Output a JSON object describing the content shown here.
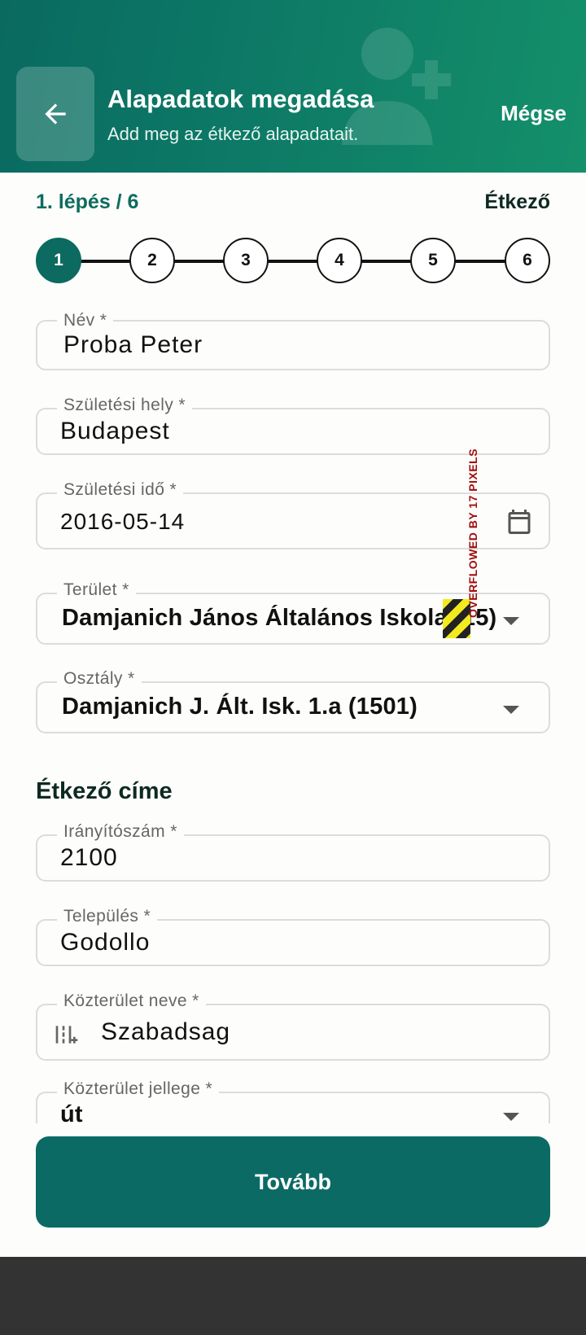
{
  "header": {
    "title": "Alapadatok megadása",
    "subtitle": "Add meg az étkező alapadatait.",
    "cancel_label": "Mégse",
    "back_icon": "arrow-left-icon",
    "decor_icon": "person-add-icon"
  },
  "progress": {
    "step_label": "1. lépés / 6",
    "role_label": "Étkező",
    "current_step": 1,
    "steps": [
      "1",
      "2",
      "3",
      "4",
      "5",
      "6"
    ]
  },
  "form": {
    "name": {
      "label": "Név *",
      "value": "Proba Peter"
    },
    "birth_place": {
      "label": "Születési hely *",
      "value": "Budapest"
    },
    "birth_date": {
      "label": "Születési idő *",
      "value": "2016-05-14",
      "icon": "calendar-icon"
    },
    "area": {
      "label": "Terület *",
      "value": "Damjanich János Általános Iskola (15)",
      "overflow_warning": "OVERFLOWED BY 17 PIXELS"
    },
    "class": {
      "label": "Osztály *",
      "value": "Damjanich J. Ált. Isk. 1.a (1501)"
    },
    "address_section_title": "Étkező címe",
    "zip": {
      "label": "Irányítószám *",
      "value": "2100"
    },
    "city": {
      "label": "Település *",
      "value": "Godollo"
    },
    "street_name": {
      "label": "Közterület neve *",
      "value": "Szabadsag",
      "icon": "street-picker-icon"
    },
    "street_type": {
      "label": "Közterület jellege *",
      "value": "út"
    }
  },
  "actions": {
    "next_label": "Tovább"
  },
  "colors": {
    "primary": "#0c6a64",
    "header_start": "#0a6a60",
    "header_end": "#14906a"
  }
}
